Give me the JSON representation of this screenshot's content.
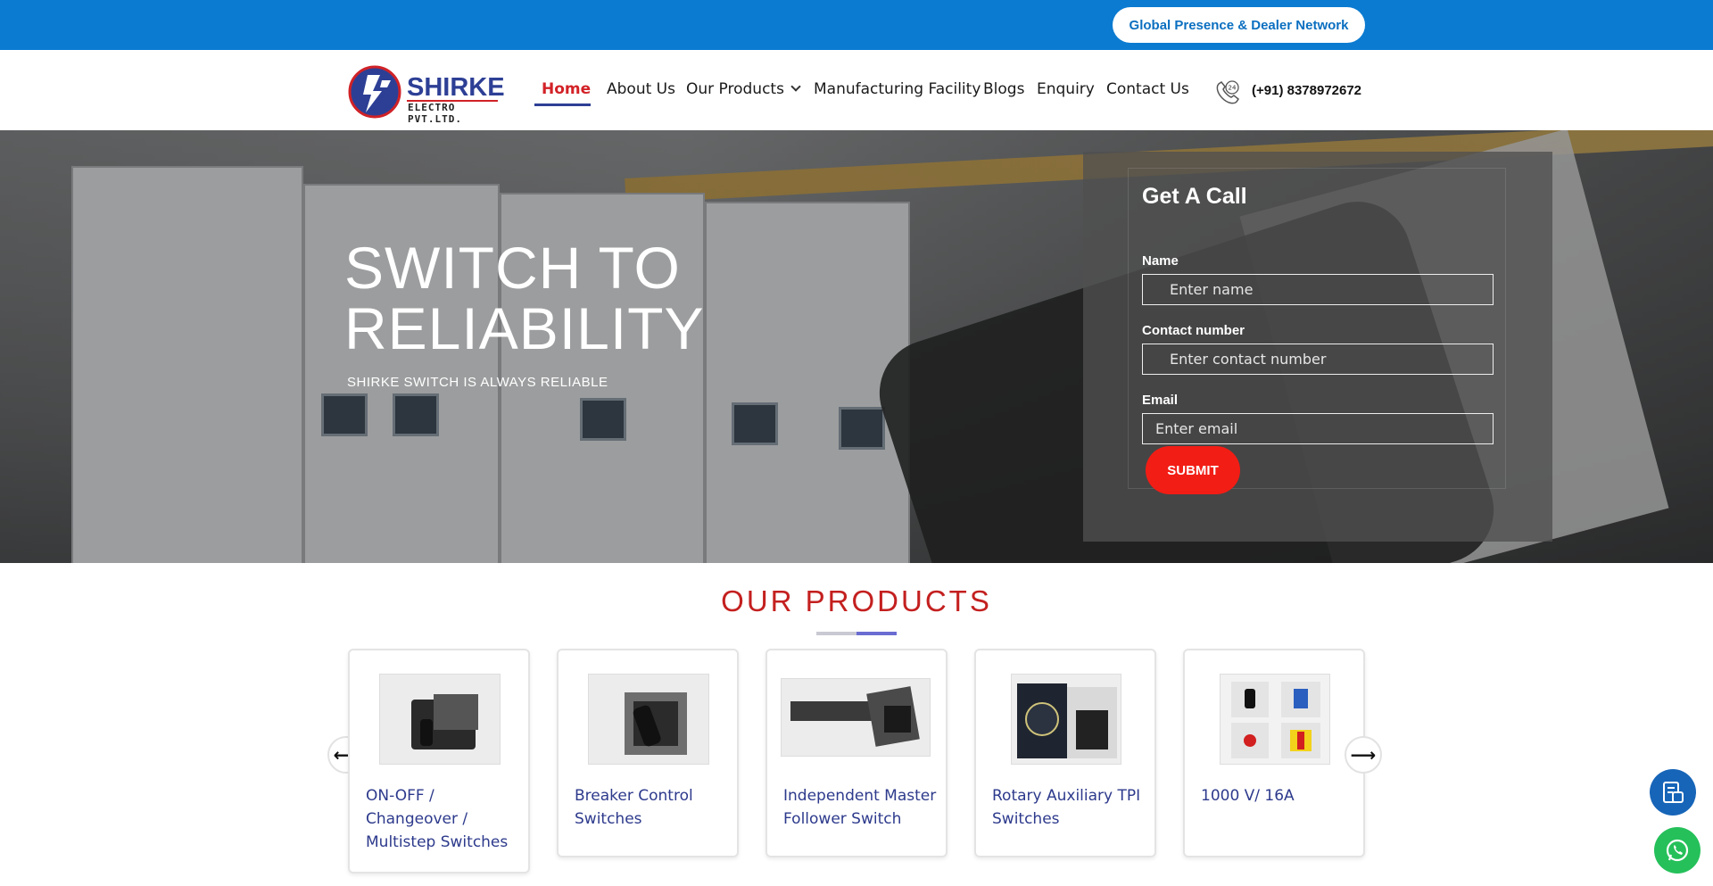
{
  "topbar": {
    "dealer_button": "Global Presence & Dealer Network"
  },
  "logo": {
    "brand": "SHIRKE",
    "sub": "ELECTRO PVT.LTD."
  },
  "nav": {
    "items": [
      "Home",
      "About Us",
      "Our Products",
      "Manufacturing Facility",
      "Blogs",
      "Enquiry",
      "Contact Us"
    ],
    "active": "Home",
    "phone": "(+91) 8378972672",
    "phone_badge": "24"
  },
  "hero": {
    "title_line1": "SWITCH TO",
    "title_line2": "RELIABILITY",
    "subtitle": "SHIRKE SWITCH IS ALWAYS RELIABLE"
  },
  "form": {
    "title": "Get A Call",
    "name_label": "Name",
    "name_placeholder": "Enter name",
    "contact_label": "Contact number",
    "contact_placeholder": "Enter contact number",
    "email_label": "Email",
    "email_placeholder": "Enter email",
    "submit": "SUBMIT"
  },
  "products": {
    "title": "OUR PRODUCTS",
    "prev_arrow": "⟵",
    "next_arrow": "⟶",
    "items": [
      {
        "label": "ON-OFF / Changeover / Multistep Switches"
      },
      {
        "label": "Breaker Control Switches"
      },
      {
        "label": "Independent Master Follower Switch"
      },
      {
        "label": "Rotary Auxiliary TPI Switches"
      },
      {
        "label": "1000 V/ 16A"
      }
    ]
  },
  "colors": {
    "topbar": "#0b7bd1",
    "accent_red": "#d22227",
    "brand_blue": "#2d3f95",
    "submit": "#f21d15",
    "whatsapp": "#25c05a"
  }
}
